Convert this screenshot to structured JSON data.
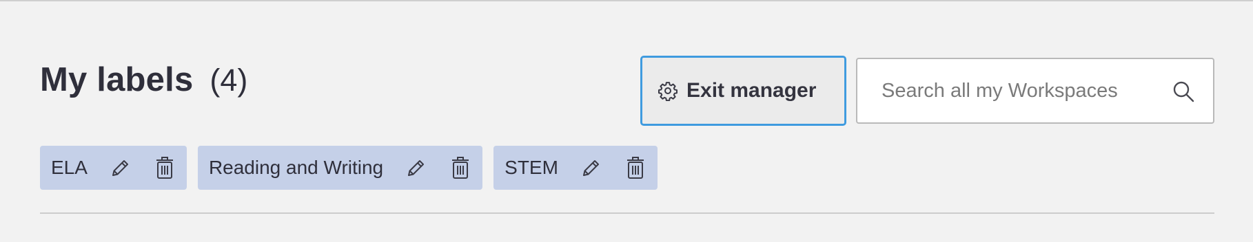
{
  "header": {
    "title": "My labels",
    "count": "(4)"
  },
  "toolbar": {
    "exit_label": "Exit manager",
    "exit_icon": "gear-icon",
    "search_placeholder": "Search all my Workspaces",
    "search_value": "",
    "search_icon": "search-icon",
    "accent_color": "#3f9bdf"
  },
  "labels": {
    "chip_color": "#c5d0e8",
    "items": [
      {
        "label": "ELA",
        "edit_icon": "pencil-icon",
        "delete_icon": "trash-icon"
      },
      {
        "label": "Reading and Writing",
        "edit_icon": "pencil-icon",
        "delete_icon": "trash-icon"
      },
      {
        "label": "STEM",
        "edit_icon": "pencil-icon",
        "delete_icon": "trash-icon"
      }
    ]
  }
}
